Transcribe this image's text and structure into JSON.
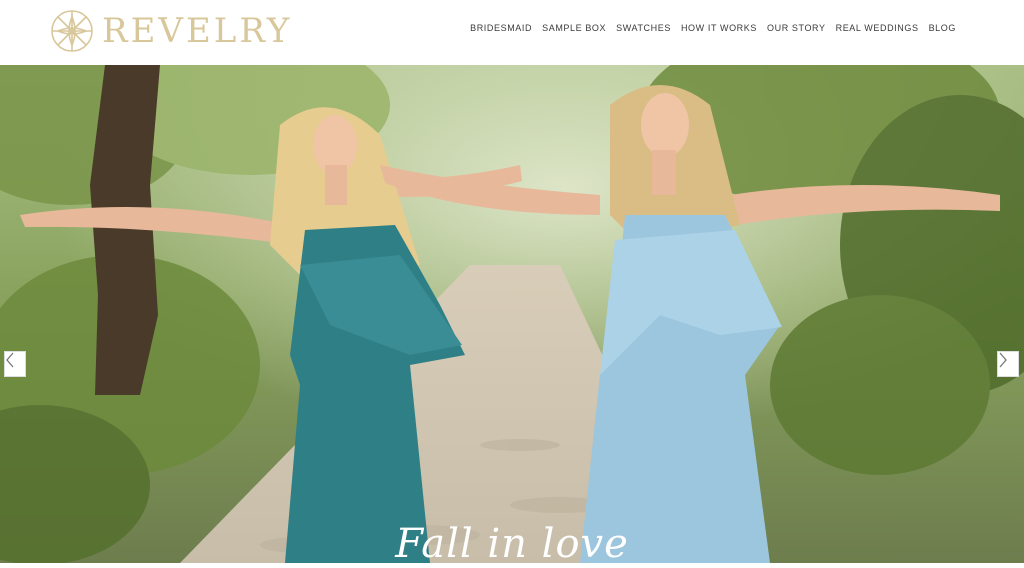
{
  "brand": {
    "name": "REVELRY",
    "accent": "#d8c79a"
  },
  "nav": {
    "items": [
      {
        "label": "BRIDESMAID"
      },
      {
        "label": "SAMPLE BOX"
      },
      {
        "label": "SWATCHES"
      },
      {
        "label": "HOW IT WORKS"
      },
      {
        "label": "OUR STORY"
      },
      {
        "label": "REAL WEDDINGS"
      },
      {
        "label": "BLOG"
      }
    ]
  },
  "hero": {
    "tagline": "Fall in love",
    "prev_icon": "chevron-left-icon",
    "next_icon": "chevron-right-icon",
    "colors": {
      "teal_dress": "#2f7f86",
      "blue_dress": "#9cc6de",
      "foliage": "#5f7d3a"
    }
  }
}
